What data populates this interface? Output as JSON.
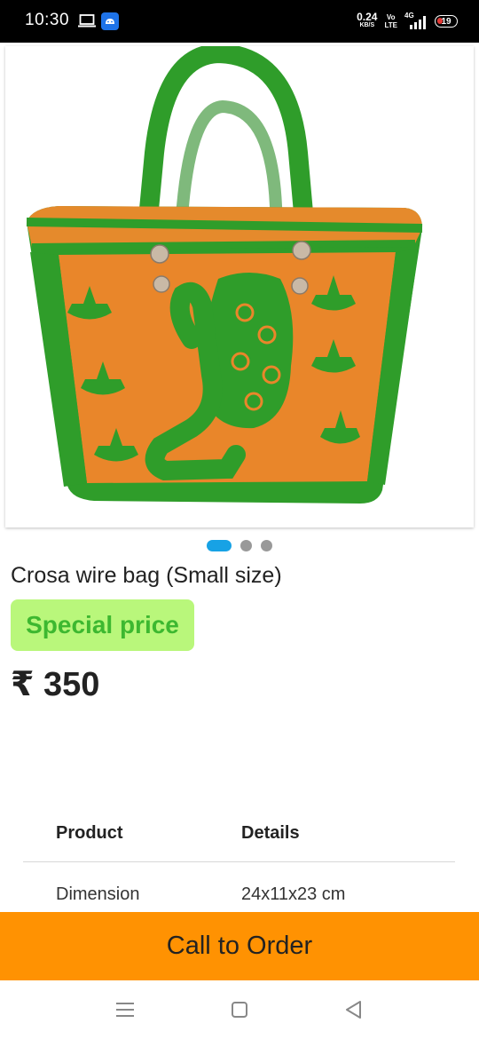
{
  "status_bar": {
    "time": "10:30",
    "net_speed_value": "0.24",
    "net_speed_unit": "KB/S",
    "volte_line1": "Vo",
    "volte_line2": "LTE",
    "network": "4G",
    "battery": "19",
    "icons": [
      "laptop-icon",
      "app-notification-icon",
      "signal-icon",
      "battery-icon"
    ]
  },
  "product": {
    "image_alt": "crochet bag image",
    "title": "Crosa wire bag (Small size)",
    "badge": "Special price",
    "price": "₹ 350",
    "carousel": {
      "count": 3,
      "active_index": 0
    }
  },
  "details": {
    "headers": [
      "Product",
      "Details"
    ],
    "rows": [
      [
        "Dimension",
        "24x11x23 cm"
      ]
    ]
  },
  "cta": {
    "label": "Call to Order",
    "color": "#ff9202"
  },
  "nav": {
    "icons": [
      "menu-icon",
      "home-icon",
      "back-icon"
    ]
  },
  "colors": {
    "accent_dot": "#17a2e5",
    "badge_bg": "#b9f77b",
    "badge_text": "#3db830"
  }
}
